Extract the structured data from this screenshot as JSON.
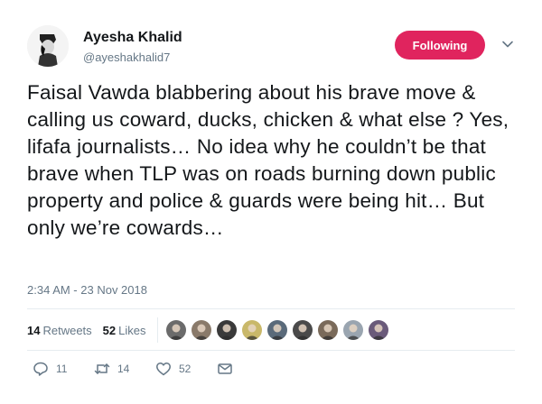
{
  "author": {
    "name": "Ayesha Khalid",
    "handle": "@ayeshakhalid7",
    "avatar_icon": "user-avatar"
  },
  "follow_button": {
    "label": "Following",
    "color": "#e0245e"
  },
  "tweet": {
    "text": "Faisal Vawda blabbering about his brave move & calling us coward, ducks, chicken & what else ? Yes, lifafa journalists… No idea why he couldn’t be that brave when TLP was on roads burning down public property and police & guards were being hit… But only we’re cowards…",
    "timestamp": "2:34 AM - 23 Nov 2018"
  },
  "stats": {
    "retweets_count": "14",
    "retweets_label": "Retweets",
    "likes_count": "52",
    "likes_label": "Likes"
  },
  "liker_avatars": [
    "#6b6b6b",
    "#8a7a6a",
    "#3a3a3a",
    "#c9b86a",
    "#5a6a7a",
    "#4a4a4a",
    "#7a6a5a",
    "#9aa5b0",
    "#6a5a7a"
  ],
  "actions": {
    "reply_count": "11",
    "retweet_count": "14",
    "like_count": "52"
  }
}
